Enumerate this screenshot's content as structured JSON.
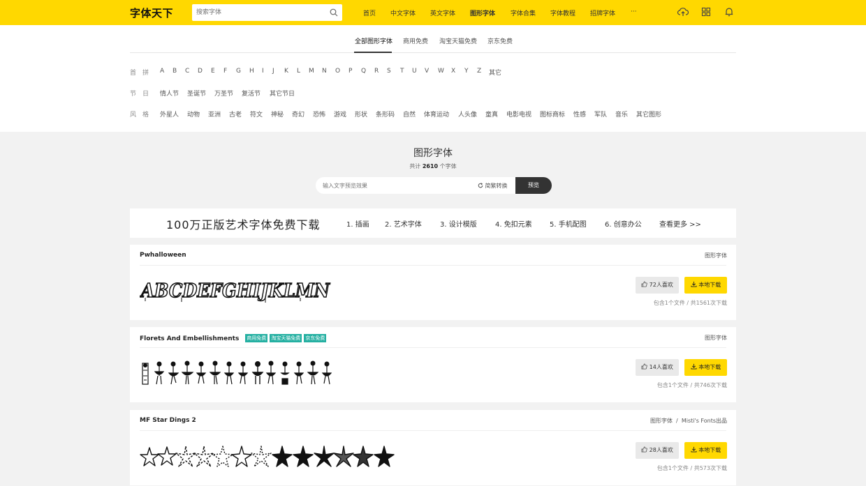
{
  "header": {
    "logo": "字体天下",
    "search_placeholder": "搜索字体",
    "nav": [
      "首页",
      "中文字体",
      "英文字体",
      "图形字体",
      "字体合集",
      "字体教程",
      "招牌字体",
      "···"
    ],
    "icons": [
      "upload-cloud-icon",
      "grid-icon",
      "notification-icon"
    ]
  },
  "tabs": [
    "全部图形字体",
    "商用免费",
    "淘宝天猫免费",
    "京东免费"
  ],
  "filters": {
    "letter_label": "首拼",
    "letters": [
      "A",
      "B",
      "C",
      "D",
      "E",
      "F",
      "G",
      "H",
      "I",
      "J",
      "K",
      "L",
      "M",
      "N",
      "O",
      "P",
      "Q",
      "R",
      "S",
      "T",
      "U",
      "V",
      "W",
      "X",
      "Y",
      "Z",
      "其它"
    ],
    "holiday_label": "节日",
    "holidays": [
      "情人节",
      "圣诞节",
      "万圣节",
      "复活节",
      "其它节日"
    ],
    "style_label": "风格",
    "styles": [
      "外星人",
      "动物",
      "亚洲",
      "古老",
      "符文",
      "神秘",
      "奇幻",
      "恐怖",
      "游戏",
      "形状",
      "条形码",
      "自然",
      "体育运动",
      "人头像",
      "童真",
      "电影电视",
      "图标商标",
      "性感",
      "军队",
      "音乐",
      "其它图形"
    ]
  },
  "section": {
    "title": "图形字体",
    "count_prefix": "共计",
    "count": "2610",
    "count_suffix": "个字体"
  },
  "preview": {
    "placeholder": "输入文字预览效果",
    "convert_label": "简繁转换",
    "button": "预览"
  },
  "banner": {
    "title": "100万正版艺术字体免费下载",
    "items": [
      "1. 插画",
      "2. 艺术字体",
      "3. 设计模版",
      "4. 免扣元素",
      "5. 手机配图",
      "6. 创意办公"
    ],
    "more": "查看更多 >>"
  },
  "fonts": [
    {
      "name": "Pwhalloween",
      "tags": [],
      "category": "图形字体",
      "likes": "72人喜欢",
      "download": "本地下载",
      "files": "包含1个文件",
      "downloads": "共1561次下载",
      "sample": "ABCDEFGHIJKLMN"
    },
    {
      "name": "Florets And Embellishments",
      "tags": [
        "商用免费",
        "淘宝天猫免费",
        "京东免费"
      ],
      "category": "图形字体",
      "likes": "14人喜欢",
      "download": "本地下载",
      "files": "包含1个文件",
      "downloads": "共746次下载",
      "sample": ""
    },
    {
      "name": "MF Star Dings 2",
      "tags": [],
      "category": "图形字体",
      "author": "Misti's Fonts出品",
      "likes": "28人喜欢",
      "download": "本地下载",
      "files": "包含1个文件",
      "downloads": "共573次下载",
      "sample": ""
    }
  ],
  "colors": {
    "accent": "#ffd800",
    "tag": "#25b0a2",
    "dark": "#333333"
  }
}
